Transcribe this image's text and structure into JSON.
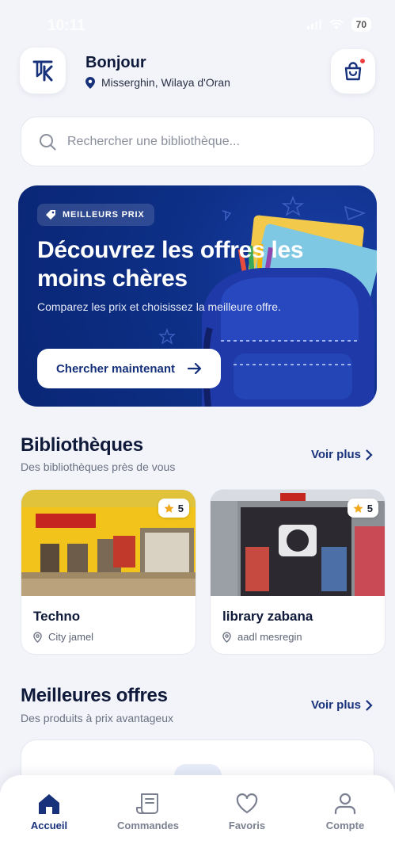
{
  "status_bar": {
    "time": "10:11",
    "battery": "70"
  },
  "header": {
    "greeting": "Bonjour",
    "location": "Misserghin, Wilaya d'Oran"
  },
  "search": {
    "placeholder": "Rechercher une bibliothèque..."
  },
  "banner": {
    "badge": "MEILLEURS PRIX",
    "title": "Découvrez les offres les moins chères",
    "subtitle": "Comparez les prix et choisissez la meilleure offre.",
    "cta": "Chercher maintenant"
  },
  "libraries": {
    "title": "Bibliothèques",
    "subtitle": "Des bibliothèques près de vous",
    "see_more": "Voir plus",
    "items": [
      {
        "name": "Techno",
        "location": "City jamel",
        "rating": "5"
      },
      {
        "name": "library zabana",
        "location": "aadl mesregin",
        "rating": "5"
      }
    ]
  },
  "offers": {
    "title": "Meilleures offres",
    "subtitle": "Des produits à prix avantageux",
    "see_more": "Voir plus"
  },
  "nav": {
    "items": [
      {
        "label": "Accueil",
        "icon": "home-icon",
        "active": true
      },
      {
        "label": "Commandes",
        "icon": "receipt-icon",
        "active": false
      },
      {
        "label": "Favoris",
        "icon": "heart-icon",
        "active": false
      },
      {
        "label": "Compte",
        "icon": "user-icon",
        "active": false
      }
    ]
  },
  "colors": {
    "brand": "#17317b",
    "banner": "#0d2f86",
    "accent_star": "#f2a81d",
    "notification": "#ef3e3e"
  }
}
